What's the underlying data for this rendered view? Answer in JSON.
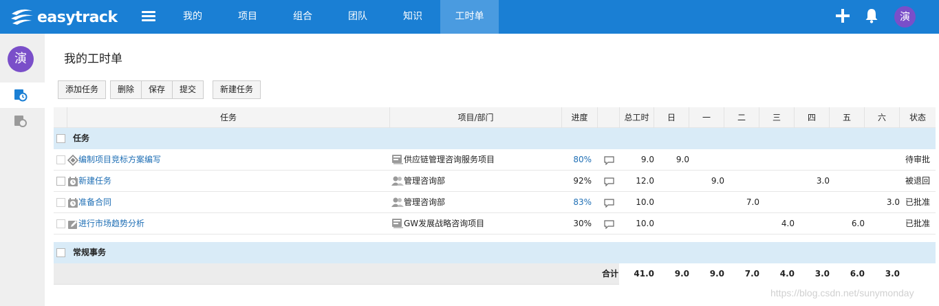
{
  "app": {
    "logo_text": "easytrack"
  },
  "nav": {
    "items": [
      {
        "label": "我的"
      },
      {
        "label": "项目"
      },
      {
        "label": "组合"
      },
      {
        "label": "团队"
      },
      {
        "label": "知识"
      },
      {
        "label": "工时单",
        "active": true
      }
    ],
    "avatar_text": "演"
  },
  "sidebar": {
    "avatar_text": "演"
  },
  "page": {
    "title": "我的工时单"
  },
  "toolbar": {
    "add_task": "添加任务",
    "delete": "删除",
    "save": "保存",
    "submit": "提交",
    "new_task": "新建任务"
  },
  "table": {
    "headers": {
      "task": "任务",
      "project": "项目/部门",
      "progress": "进度",
      "total": "总工时",
      "sun": "日",
      "mon": "一",
      "tue": "二",
      "wed": "三",
      "thu": "四",
      "fri": "五",
      "sat": "六",
      "status": "状态"
    },
    "group_tasks": "任务",
    "rows": [
      {
        "icon": "milestone-icon",
        "name": "编制项目竞标方案编写",
        "project_icon": "project-icon",
        "project": "供应链管理咨询服务项目",
        "progress": "80%",
        "progress_link": true,
        "total": "9.0",
        "sun": "9.0",
        "mon": "",
        "tue": "",
        "wed": "",
        "thu": "",
        "fri": "",
        "sat": "",
        "status": "待审批"
      },
      {
        "icon": "clock-task-icon",
        "name": "新建任务",
        "project_icon": "department-icon",
        "project": "管理咨询部",
        "progress": "92%",
        "progress_link": false,
        "total": "12.0",
        "sun": "",
        "mon": "9.0",
        "tue": "",
        "wed": "",
        "thu": "3.0",
        "fri": "",
        "sat": "",
        "status": "被退回"
      },
      {
        "icon": "clock-task-icon",
        "name": "准备合同",
        "project_icon": "department-icon",
        "project": "管理咨询部",
        "progress": "83%",
        "progress_link": true,
        "total": "10.0",
        "sun": "",
        "mon": "",
        "tue": "7.0",
        "wed": "",
        "thu": "",
        "fri": "",
        "sat": "3.0",
        "status": "已批准"
      },
      {
        "icon": "edit-task-icon",
        "name": "进行市场趋势分析",
        "project_icon": "project-icon",
        "project": "GW发展战略咨询项目",
        "progress": "30%",
        "progress_link": false,
        "total": "10.0",
        "sun": "",
        "mon": "",
        "tue": "",
        "wed": "4.0",
        "thu": "",
        "fri": "6.0",
        "sat": "",
        "status": "已批准"
      }
    ],
    "group_routine": "常规事务",
    "totals": {
      "label": "合计",
      "total": "41.0",
      "sun": "9.0",
      "mon": "9.0",
      "tue": "7.0",
      "wed": "4.0",
      "thu": "3.0",
      "fri": "6.0",
      "sat": "3.0"
    }
  },
  "watermark": "https://blog.csdn.net/sunymonday",
  "colors": {
    "topbar": "#1a7fd4",
    "active_nav": "#4a9be0",
    "avatar": "#7a4fc9",
    "group_bg": "#d9ebf7",
    "link": "#1f6fb5"
  }
}
